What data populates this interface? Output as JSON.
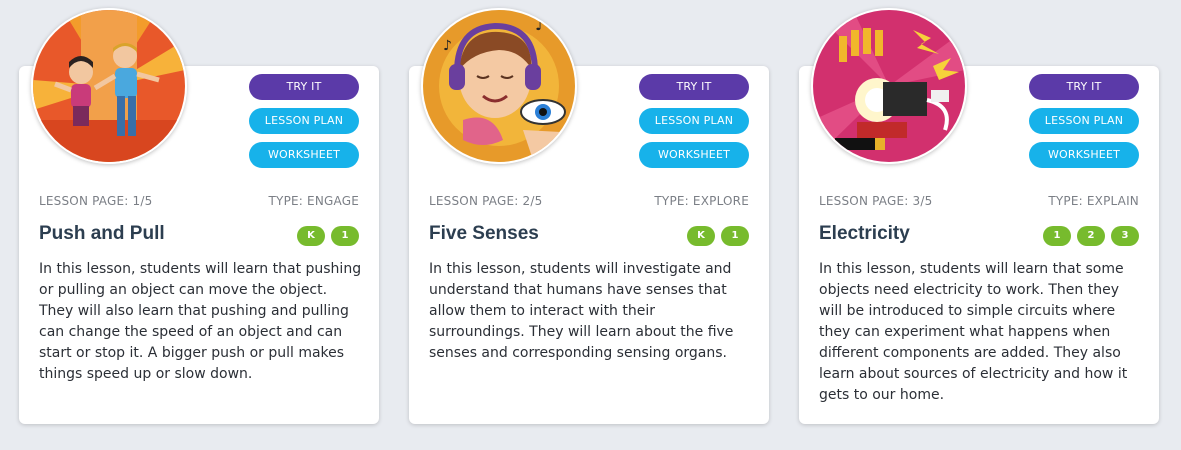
{
  "cards": [
    {
      "title": "Push and Pull",
      "lesson_page": "LESSON PAGE: 1/5",
      "type": "TYPE: ENGAGE",
      "grades": [
        "K",
        "1"
      ],
      "buttons": {
        "try": "TRY IT",
        "plan": "LESSON PLAN",
        "worksheet": "WORKSHEET"
      },
      "description": "In this lesson, students will learn that pushing or pulling an object can move the object. They will also learn that pushing and pulling can change the speed of an object and can start or stop it. A bigger push or pull makes things speed up or slow down.",
      "image_icon": "push-pull-illustration"
    },
    {
      "title": "Five Senses",
      "lesson_page": "LESSON PAGE: 2/5",
      "type": "TYPE: EXPLORE",
      "grades": [
        "K",
        "1"
      ],
      "buttons": {
        "try": "TRY IT",
        "plan": "LESSON PLAN",
        "worksheet": "WORKSHEET"
      },
      "description": "In this lesson, students will investigate and understand that humans have senses that allow them to interact with their surroundings. They will learn about the five senses and corresponding sensing organs.",
      "image_icon": "five-senses-illustration"
    },
    {
      "title": "Electricity",
      "lesson_page": "LESSON PAGE: 3/5",
      "type": "TYPE: EXPLAIN",
      "grades": [
        "1",
        "2",
        "3"
      ],
      "buttons": {
        "try": "TRY IT",
        "plan": "LESSON PLAN",
        "worksheet": "WORKSHEET"
      },
      "description": "In this lesson, students will learn that some objects need electricity to work. Then they will be introduced to simple circuits where they can experiment what happens when different components are added. They also learn about sources of electricity and how it gets to our home.",
      "image_icon": "electricity-illustration"
    }
  ],
  "colors": {
    "background": "#e8ebf0",
    "try_button": "#5b3aa8",
    "secondary_button": "#17b2ea",
    "grade_badge": "#77bb2d",
    "title": "#2c3e50"
  }
}
